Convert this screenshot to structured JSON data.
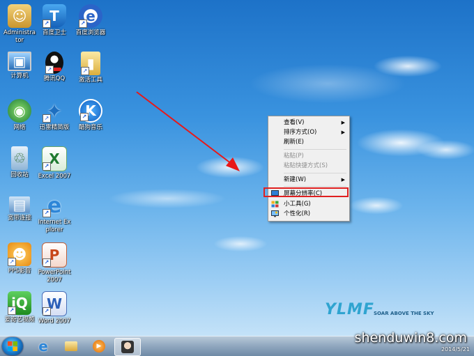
{
  "desktop_icons": [
    {
      "id": "administrator",
      "label": "Administrator",
      "glyph": "☺",
      "color": "#d9a93c"
    },
    {
      "id": "baidu-guard",
      "label": "百度卫士",
      "glyph": "T",
      "color": "#1f7fd8"
    },
    {
      "id": "baidu-browser",
      "label": "百度浏览器",
      "glyph": "e",
      "color": "#2b64c8"
    },
    {
      "id": "computer",
      "label": "计算机",
      "glyph": "▣",
      "color": "#3b8ad6"
    },
    {
      "id": "tencent-qq",
      "label": "腾讯QQ",
      "glyph": "●",
      "color": "#222222"
    },
    {
      "id": "activation-tool",
      "label": "激活工具",
      "glyph": "▮",
      "color": "#e6c25a"
    },
    {
      "id": "network",
      "label": "网络",
      "glyph": "◉",
      "color": "#2a8a3e"
    },
    {
      "id": "thunder",
      "label": "迅雷精简版",
      "glyph": "✦",
      "color": "#2e7fc6"
    },
    {
      "id": "kugou-music",
      "label": "酷狗音乐",
      "glyph": "K",
      "color": "#1a78d6"
    },
    {
      "id": "recycle-bin",
      "label": "回收站",
      "glyph": "♲",
      "color": "#7aa8cc"
    },
    {
      "id": "excel-2007",
      "label": "Excel 2007",
      "glyph": "X",
      "color": "#2a8a3a"
    },
    {
      "id": "broadband",
      "label": "宽带连接",
      "glyph": "▤",
      "color": "#6a9ed0"
    },
    {
      "id": "internet-explorer",
      "label": "Internet Explorer",
      "glyph": "e",
      "color": "#2d86d8"
    },
    {
      "id": "pps",
      "label": "PPS影音",
      "glyph": "☻",
      "color": "#f0a020"
    },
    {
      "id": "powerpoint-2007",
      "label": "PowerPoint 2007",
      "glyph": "P",
      "color": "#d04a1c"
    },
    {
      "id": "iqiyi",
      "label": "爱奇艺视频",
      "glyph": "i",
      "color": "#3aa83a"
    },
    {
      "id": "word-2007",
      "label": "Word 2007",
      "glyph": "W",
      "color": "#2b5fb8"
    }
  ],
  "context_menu": {
    "items": [
      {
        "id": "view",
        "label": "查看(V)",
        "submenu": true,
        "disabled": false
      },
      {
        "id": "sort-by",
        "label": "排序方式(O)",
        "submenu": true,
        "disabled": false
      },
      {
        "id": "refresh",
        "label": "刷新(E)",
        "submenu": false,
        "disabled": false
      },
      {
        "id": "paste",
        "label": "粘贴(P)",
        "submenu": false,
        "disabled": true
      },
      {
        "id": "paste-shortcut",
        "label": "粘贴快捷方式(S)",
        "submenu": false,
        "disabled": true
      },
      {
        "id": "new",
        "label": "新建(W)",
        "submenu": true,
        "disabled": false
      },
      {
        "id": "screen-resolution",
        "label": "屏幕分辨率(C)",
        "submenu": false,
        "disabled": false,
        "highlighted": true
      },
      {
        "id": "gadgets",
        "label": "小工具(G)",
        "submenu": false,
        "disabled": false
      },
      {
        "id": "personalize",
        "label": "个性化(R)",
        "submenu": false,
        "disabled": false
      }
    ],
    "submenu_arrow": "▶",
    "highlight_color": "#e02020"
  },
  "logo": {
    "brand": "YLMF",
    "slogan": "SOAR ABOVE THE SKY"
  },
  "watermark": "shenduwin8.com",
  "taskbar": {
    "clock_date": "2014/5/21",
    "pinned": [
      {
        "id": "ie",
        "glyph": "e",
        "color": "#2d86d8"
      },
      {
        "id": "explorer",
        "glyph": "▬",
        "color": "#e8c35a"
      },
      {
        "id": "media-player",
        "glyph": "▶",
        "color": "#f08a1a"
      },
      {
        "id": "user-avatar",
        "glyph": "☺",
        "color": "#444444"
      }
    ]
  }
}
